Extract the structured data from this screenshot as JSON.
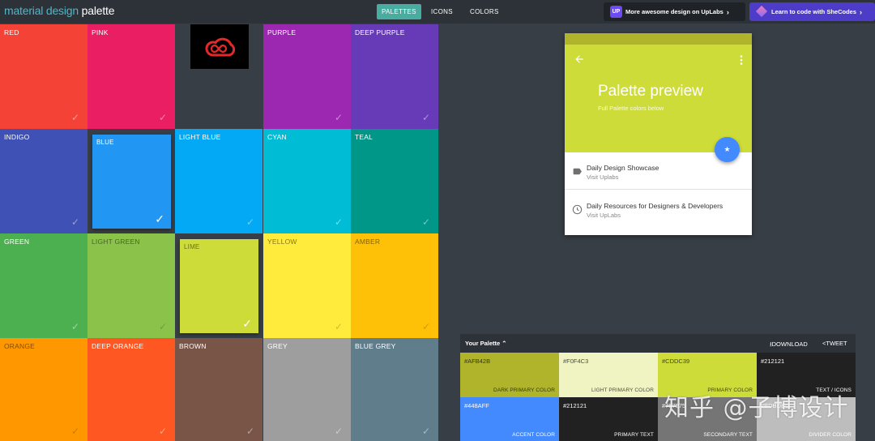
{
  "app": {
    "logo_part1": "material design",
    "logo_part2": "palette"
  },
  "nav": {
    "tabs": [
      {
        "label": "PALETTES",
        "active": true
      },
      {
        "label": "ICONS",
        "active": false
      },
      {
        "label": "COLORS",
        "active": false
      }
    ]
  },
  "promos": {
    "uplabs": {
      "icon_text": "UP",
      "label": "More awesome design on UpLabs",
      "arrow": "›"
    },
    "shecodes": {
      "label": "Learn to code with SheCodes",
      "arrow": "›"
    }
  },
  "palette_colors": [
    {
      "name": "RED",
      "color": "#f44336",
      "text": "light",
      "selected": false
    },
    {
      "name": "PINK",
      "color": "#e91e63",
      "text": "light",
      "selected": false
    },
    {
      "name": "",
      "color": "#373e45",
      "text": "light",
      "selected": false,
      "empty": true
    },
    {
      "name": "PURPLE",
      "color": "#9c27b0",
      "text": "light",
      "selected": false
    },
    {
      "name": "DEEP PURPLE",
      "color": "#673ab7",
      "text": "light",
      "selected": false
    },
    {
      "name": "INDIGO",
      "color": "#3f51b5",
      "text": "light",
      "selected": false
    },
    {
      "name": "BLUE",
      "color": "#2196f3",
      "text": "light",
      "selected": true
    },
    {
      "name": "LIGHT BLUE",
      "color": "#03a9f4",
      "text": "light",
      "selected": false
    },
    {
      "name": "CYAN",
      "color": "#00bcd4",
      "text": "light",
      "selected": false
    },
    {
      "name": "TEAL",
      "color": "#009688",
      "text": "light",
      "selected": false
    },
    {
      "name": "GREEN",
      "color": "#4caf50",
      "text": "light",
      "selected": false
    },
    {
      "name": "LIGHT GREEN",
      "color": "#8bc34a",
      "text": "dark",
      "selected": false
    },
    {
      "name": "LIME",
      "color": "#cddc39",
      "text": "dark",
      "selected": true
    },
    {
      "name": "YELLOW",
      "color": "#ffeb3b",
      "text": "dark",
      "selected": false
    },
    {
      "name": "AMBER",
      "color": "#ffc107",
      "text": "dark",
      "selected": false
    },
    {
      "name": "ORANGE",
      "color": "#ff9800",
      "text": "dark",
      "selected": false
    },
    {
      "name": "DEEP ORANGE",
      "color": "#ff5722",
      "text": "light",
      "selected": false
    },
    {
      "name": "BROWN",
      "color": "#795548",
      "text": "light",
      "selected": false
    },
    {
      "name": "GREY",
      "color": "#9e9e9e",
      "text": "light",
      "selected": false
    },
    {
      "name": "BLUE GREY",
      "color": "#607d8b",
      "text": "light",
      "selected": false
    }
  ],
  "check_glyph": "✓",
  "preview": {
    "title": "Palette preview",
    "subtitle": "Full Palette colors below",
    "fab_icon": "star-icon",
    "fab_glyph": "★",
    "items": [
      {
        "title": "Daily Design Showcase",
        "subtitle": "Visit Uplabs",
        "icon": "label-icon"
      },
      {
        "title": "Daily Resources for Designers & Developers",
        "subtitle": "Visit UpLabs",
        "icon": "clock-icon"
      }
    ]
  },
  "your_palette": {
    "title": "Your Palette ⌃",
    "download_label": "⭳DOWNLOAD",
    "tweet_label": "<TWEET",
    "swatches": [
      {
        "hex": "#AFB42B",
        "role": "DARK PRIMARY COLOR",
        "color": "#afb42b",
        "text": "dark"
      },
      {
        "hex": "#F0F4C3",
        "role": "LIGHT PRIMARY COLOR",
        "color": "#f0f4c3",
        "text": "dark"
      },
      {
        "hex": "#CDDC39",
        "role": "PRIMARY COLOR",
        "color": "#cddc39",
        "text": "dark"
      },
      {
        "hex": "#212121",
        "role": "TEXT / ICONS",
        "color": "#212121",
        "text": "light"
      },
      {
        "hex": "#448AFF",
        "role": "ACCENT COLOR",
        "color": "#448aff",
        "text": "light"
      },
      {
        "hex": "#212121",
        "role": "PRIMARY TEXT",
        "color": "#212121",
        "text": "light"
      },
      {
        "hex": "#757575",
        "role": "SECONDARY TEXT",
        "color": "#757575",
        "text": "light"
      },
      {
        "hex": "#BDBDBD",
        "role": "DIVIDER COLOR",
        "color": "#bdbdbd",
        "text": "light"
      }
    ]
  },
  "watermark": "知乎 @子博设计"
}
